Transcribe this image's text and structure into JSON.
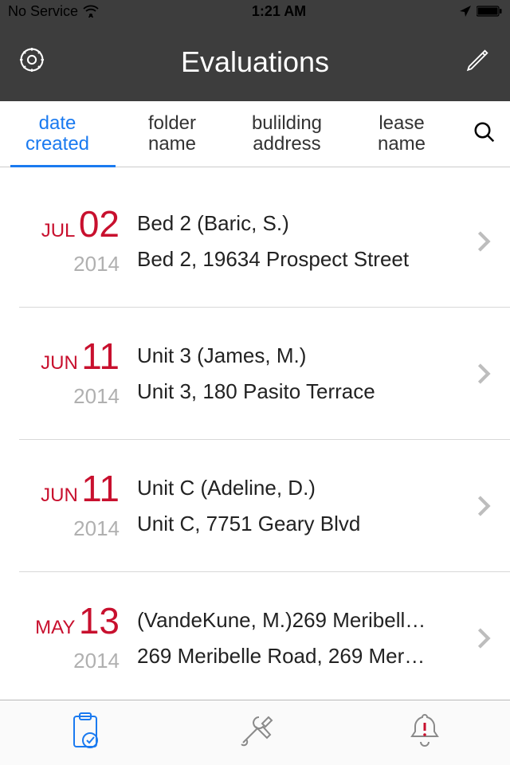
{
  "status": {
    "carrier": "No Service",
    "time": "1:21 AM"
  },
  "nav": {
    "title": "Evaluations"
  },
  "tabs": [
    {
      "label_line1": "date",
      "label_line2": "created",
      "active": true
    },
    {
      "label_line1": "folder",
      "label_line2": "name",
      "active": false
    },
    {
      "label_line1": "bulilding",
      "label_line2": "address",
      "active": false
    },
    {
      "label_line1": "lease",
      "label_line2": "name",
      "active": false
    }
  ],
  "rows": [
    {
      "month": "JUL",
      "day": "02",
      "year": "2014",
      "title": "Bed 2 (Baric, S.)",
      "sub": "Bed 2, 19634 Prospect Street"
    },
    {
      "month": "JUN",
      "day": "11",
      "year": "2014",
      "title": "Unit 3 (James, M.)",
      "sub": "Unit 3, 180 Pasito Terrace"
    },
    {
      "month": "JUN",
      "day": "11",
      "year": "2014",
      "title": "Unit C (Adeline, D.)",
      "sub": "Unit C, 7751 Geary Blvd"
    },
    {
      "month": "MAY",
      "day": "13",
      "year": "2014",
      "title": "(VandeKune, M.)269 Meribell…",
      "sub": "269 Meribelle Road, 269 Mer…"
    }
  ],
  "colors": {
    "accent": "#1a7af0",
    "date": "#c8102e"
  }
}
